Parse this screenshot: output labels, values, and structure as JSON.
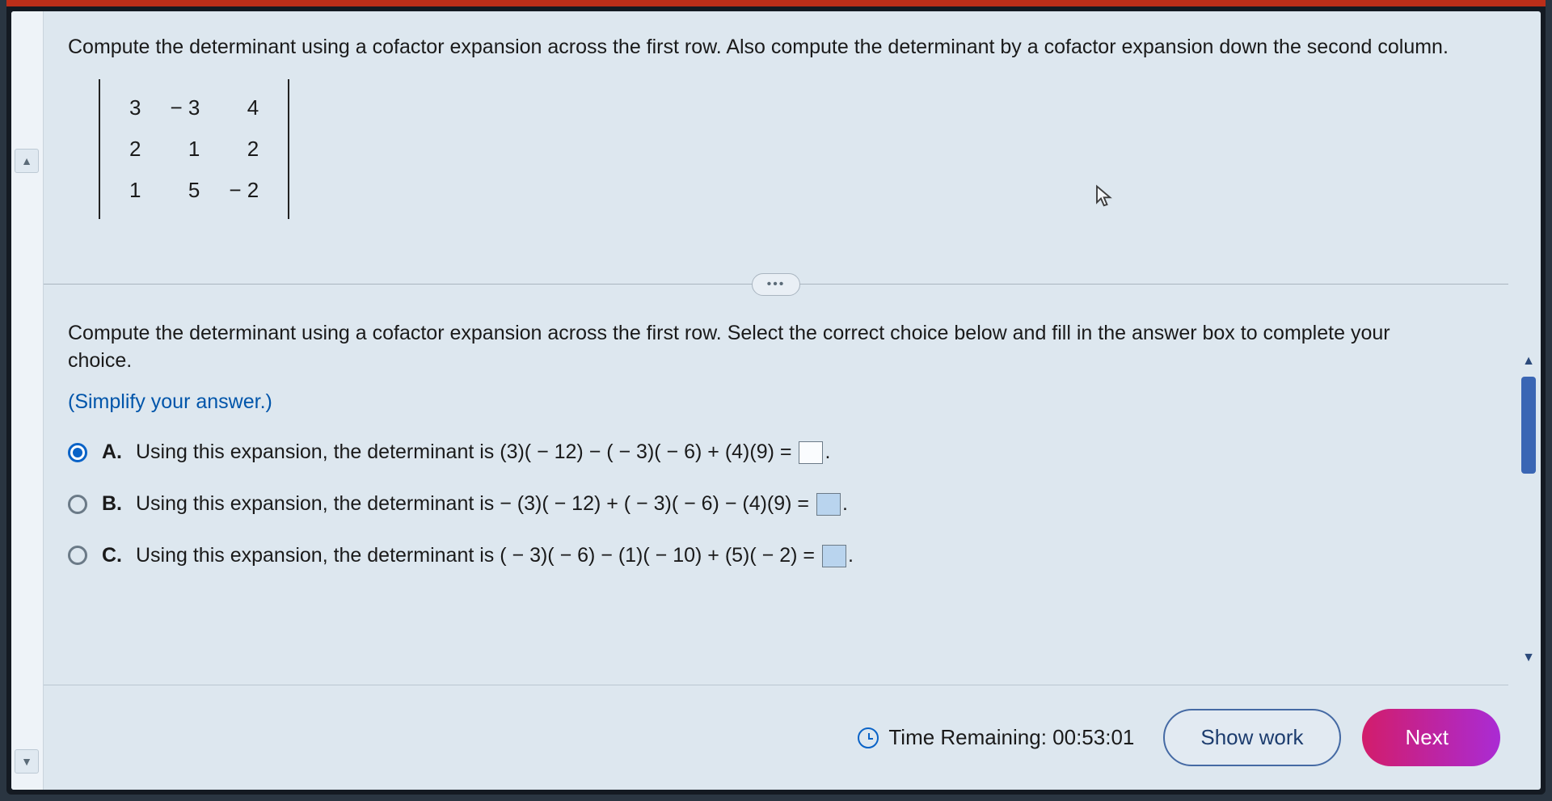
{
  "question": {
    "prompt": "Compute the determinant using a cofactor expansion across the first row. Also compute the determinant by a cofactor expansion down the second column.",
    "matrix": {
      "r1c1": "3",
      "r1c2": "− 3",
      "r1c3": "4",
      "r2c1": "2",
      "r2c2": "1",
      "r2c3": "2",
      "r3c1": "1",
      "r3c2": "5",
      "r3c3": "− 2"
    }
  },
  "pill": "•••",
  "instruction": "Compute the determinant using a cofactor expansion across the first row. Select the correct choice below and fill in the answer box to complete your choice.",
  "instruction_note": "(Simplify your answer.)",
  "choices": {
    "a": {
      "label": "A.",
      "lead": "Using this expansion, the determinant is ",
      "expr": "(3)( − 12) − ( − 3)( − 6) + (4)(9) =",
      "tail": "."
    },
    "b": {
      "label": "B.",
      "lead": "Using this expansion, the determinant is ",
      "expr": "− (3)( − 12) + ( − 3)( − 6) − (4)(9) =",
      "tail": "."
    },
    "c": {
      "label": "C.",
      "lead": "Using this expansion, the determinant is ",
      "expr": "( − 3)( − 6) − (1)( − 10) + (5)( − 2) =",
      "tail": "."
    }
  },
  "footer": {
    "timer_label": "Time Remaining:",
    "timer_value": "00:53:01",
    "show_work": "Show work",
    "next": "Next"
  },
  "icons": {
    "up": "▲",
    "down": "▼"
  }
}
